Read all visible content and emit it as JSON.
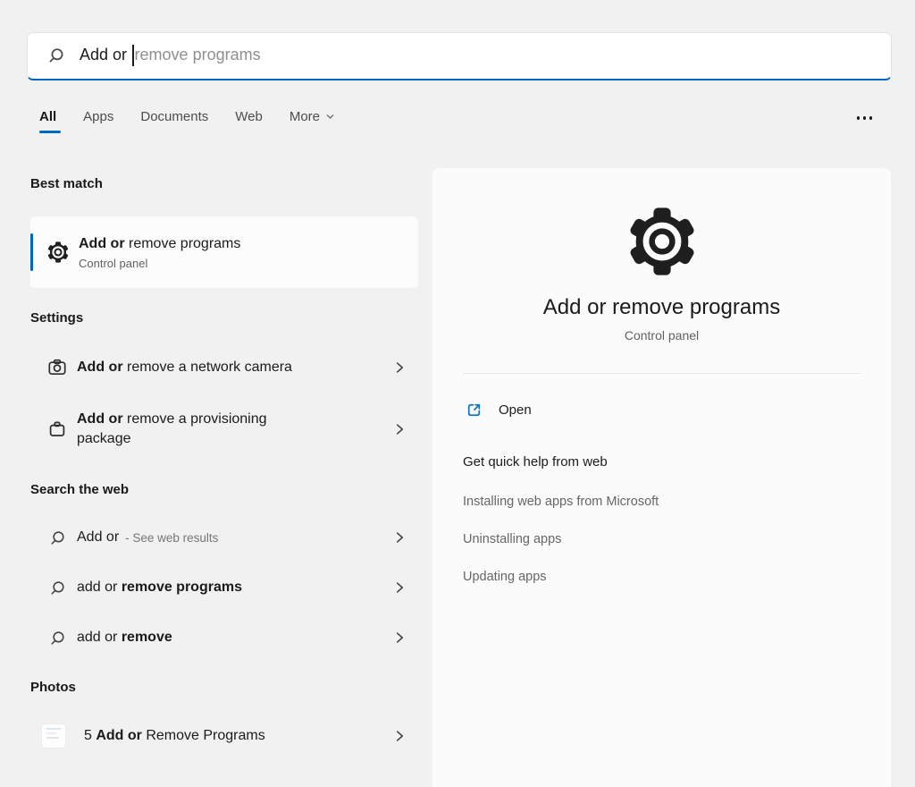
{
  "colors": {
    "accent": "#0067c0",
    "page_bg": "#f1f1f2",
    "panel_bg": "#fbfbfc",
    "text_primary": "#1b1b1b",
    "text_secondary": "#616161",
    "suggestion_text": "#8f8f8f",
    "divider": "#e7e7e7"
  },
  "icons": {
    "search": "magnifier-glyph",
    "gear": "gear-outline-glyph",
    "camera": "camera-outline-glyph",
    "package": "briefcase-outline-glyph",
    "chevron_right": "chevron-right-glyph",
    "chevron_down": "chevron-down-glyph",
    "more_options": "three-dots",
    "external_link": "open-external-glyph",
    "photo": "photo-thumbnail"
  },
  "search": {
    "typed": "Add or ",
    "suggestion": "remove programs"
  },
  "tabs": {
    "items": [
      {
        "label": "All",
        "active": true
      },
      {
        "label": "Apps",
        "active": false
      },
      {
        "label": "Documents",
        "active": false
      },
      {
        "label": "Web",
        "active": false
      },
      {
        "label": "More",
        "active": false,
        "has_chevron": true
      }
    ]
  },
  "left": {
    "best_match": {
      "header": "Best match",
      "item": {
        "title_bold": "Add or",
        "title_rest": " remove programs",
        "subtitle": "Control panel"
      }
    },
    "settings": {
      "header": "Settings",
      "items": [
        {
          "bold": "Add or",
          "rest": " remove a network camera"
        },
        {
          "bold": "Add or",
          "rest": " remove a provisioning package"
        }
      ]
    },
    "web": {
      "header": "Search the web",
      "items": [
        {
          "prefix": "Add or",
          "note": "- See web results"
        },
        {
          "prefix": "add or ",
          "bold": "remove programs"
        },
        {
          "prefix": "add or ",
          "bold": "remove"
        }
      ]
    },
    "photos": {
      "header": "Photos",
      "items": [
        {
          "prefix": "5 ",
          "bold": "Add or",
          "rest": " Remove Programs"
        }
      ]
    }
  },
  "preview": {
    "title": "Add or remove programs",
    "subtitle": "Control panel",
    "open_label": "Open",
    "help_header": "Get quick help from web",
    "help_links": [
      "Installing web apps from Microsoft",
      "Uninstalling apps",
      "Updating apps"
    ]
  }
}
